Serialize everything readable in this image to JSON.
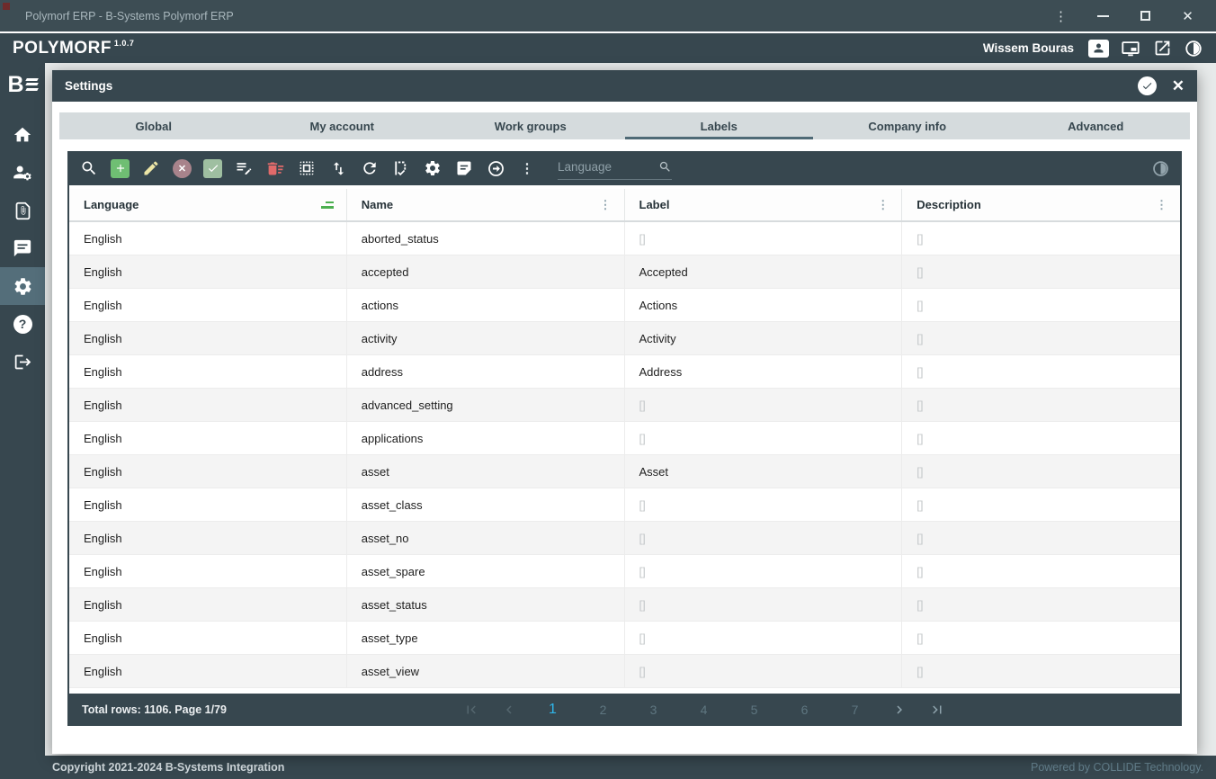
{
  "window": {
    "title": "Polymorf ERP - B-Systems Polymorf ERP"
  },
  "appbar": {
    "brand": "POLYMORF",
    "version": "1.0.7",
    "user_name": "Wissem Bouras",
    "icons": [
      "user-badge",
      "display",
      "open-in-new",
      "contrast"
    ]
  },
  "sidebar": {
    "logo": "B",
    "items": [
      {
        "icon": "home",
        "active": false
      },
      {
        "icon": "user-settings",
        "active": false
      },
      {
        "icon": "document-attachment",
        "active": false
      },
      {
        "icon": "message",
        "active": false
      },
      {
        "icon": "settings",
        "active": true
      },
      {
        "icon": "help",
        "active": false
      },
      {
        "icon": "logout",
        "active": false
      }
    ]
  },
  "dialog": {
    "title": "Settings",
    "header_icons": [
      "check-circle",
      "close"
    ],
    "tabs": [
      {
        "label": "Global",
        "active": false
      },
      {
        "label": "My account",
        "active": false
      },
      {
        "label": "Work groups",
        "active": false
      },
      {
        "label": "Labels",
        "active": true
      },
      {
        "label": "Company info",
        "active": false
      },
      {
        "label": "Advanced",
        "active": false
      }
    ],
    "toolbar": {
      "search_placeholder": "Language",
      "icons": [
        "search",
        "add",
        "edit",
        "cancel",
        "validate",
        "edit-list",
        "delete-sweep",
        "select-all",
        "sort",
        "refresh",
        "rules-check",
        "settings",
        "note",
        "forward-circle",
        "more-menu",
        "contrast-toggle"
      ]
    },
    "table": {
      "columns": [
        {
          "label": "Language",
          "icon": "filter-active"
        },
        {
          "label": "Name",
          "icon": "column-menu"
        },
        {
          "label": "Label",
          "icon": "column-menu"
        },
        {
          "label": "Description",
          "icon": "column-menu"
        }
      ],
      "empty_value": "[]",
      "rows": [
        [
          "English",
          "aborted_status",
          "[]",
          "[]"
        ],
        [
          "English",
          "accepted",
          "Accepted",
          "[]"
        ],
        [
          "English",
          "actions",
          "Actions",
          "[]"
        ],
        [
          "English",
          "activity",
          "Activity",
          "[]"
        ],
        [
          "English",
          "address",
          "Address",
          "[]"
        ],
        [
          "English",
          "advanced_setting",
          "[]",
          "[]"
        ],
        [
          "English",
          "applications",
          "[]",
          "[]"
        ],
        [
          "English",
          "asset",
          "Asset",
          "[]"
        ],
        [
          "English",
          "asset_class",
          "[]",
          "[]"
        ],
        [
          "English",
          "asset_no",
          "[]",
          "[]"
        ],
        [
          "English",
          "asset_spare",
          "[]",
          "[]"
        ],
        [
          "English",
          "asset_status",
          "[]",
          "[]"
        ],
        [
          "English",
          "asset_type",
          "[]",
          "[]"
        ],
        [
          "English",
          "asset_view",
          "[]",
          "[]"
        ]
      ]
    },
    "pagination": {
      "summary": "Total rows: 1106. Page 1/79",
      "pages": [
        "1",
        "2",
        "3",
        "4",
        "5",
        "6",
        "7"
      ],
      "active_page": "1",
      "nav": [
        "first-page",
        "previous-page",
        "next-page",
        "last-page"
      ]
    }
  },
  "footer": {
    "copyright": "Copyright 2021-2024 B-Systems Integration",
    "powered_by": "Powered by COLLIDE Technology."
  },
  "colors": {
    "header_dark": "#37474F",
    "sidebar_active": "#546E7A",
    "tab_bar": "#D5DBDD",
    "tab_indicator": "#4F6A76",
    "active_page_accent": "#2FB6EA",
    "add_green": "#6FBE73",
    "edit_yellow": "#EDE6A6",
    "cancel_rose": "#A8838B",
    "check_sage": "#9FBFA1",
    "delete_red": "#E06A6A",
    "filter_green": "#4CAF50",
    "row_alt": "#F4F4F4",
    "muted_cell": "#C4C8CA"
  }
}
